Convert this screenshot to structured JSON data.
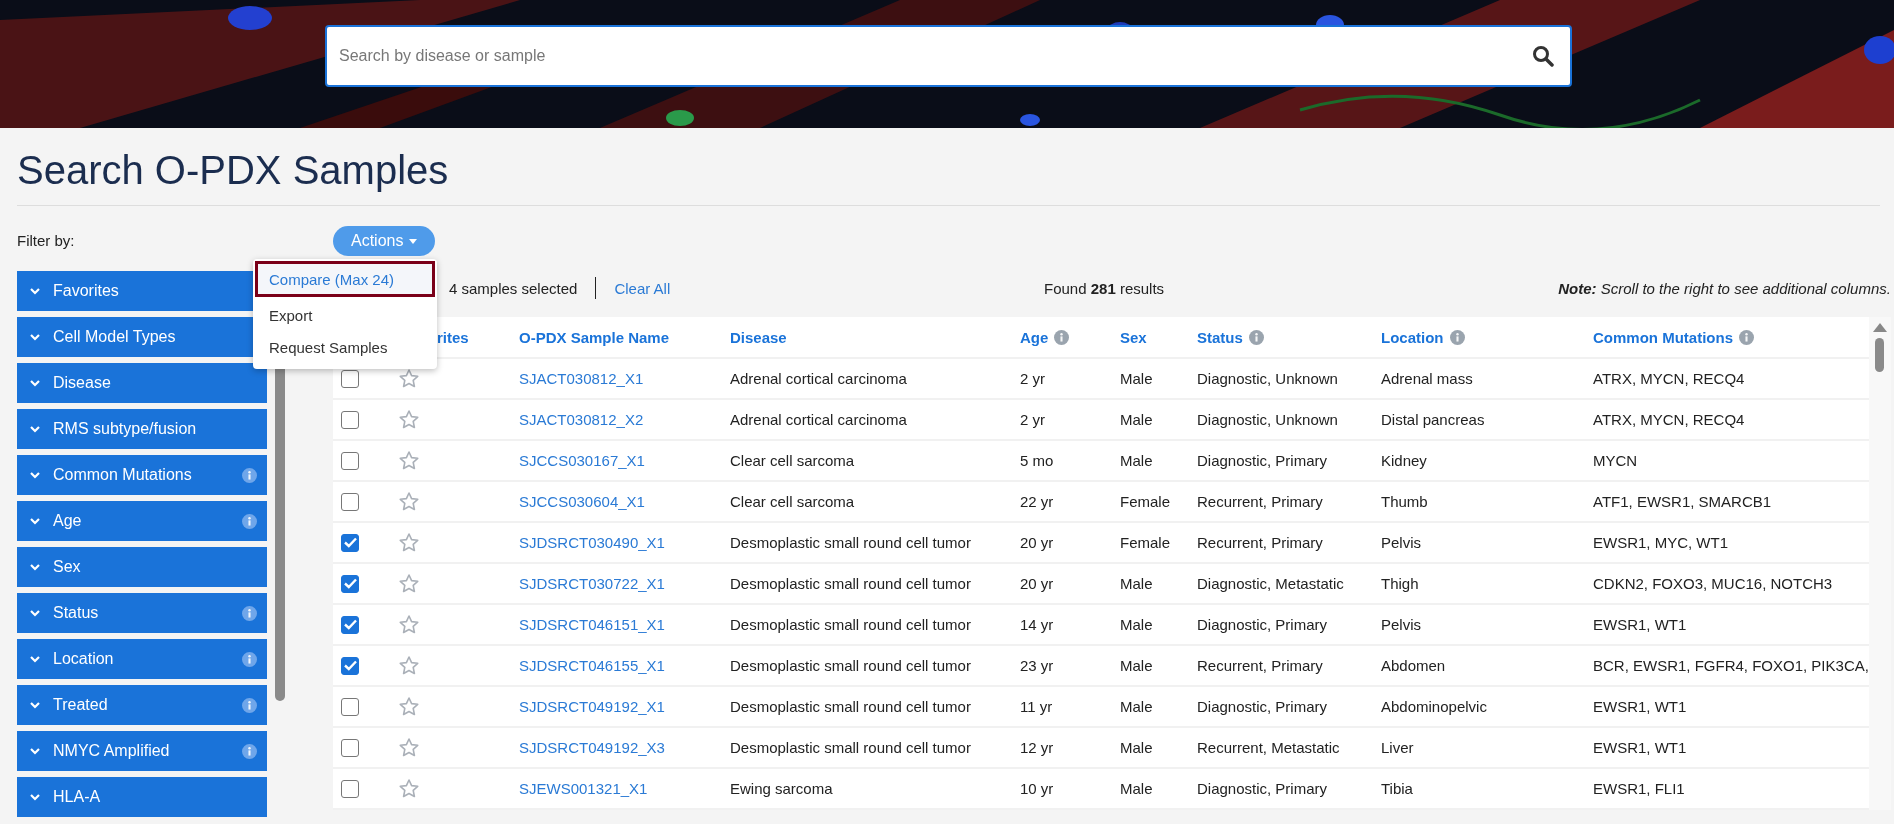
{
  "search": {
    "placeholder": "Search by disease or sample"
  },
  "title": "Search O-PDX Samples",
  "filter_label": "Filter by:",
  "filters": [
    {
      "label": "Favorites",
      "info": false
    },
    {
      "label": "Cell Model Types",
      "info": false
    },
    {
      "label": "Disease",
      "info": false
    },
    {
      "label": "RMS subtype/fusion",
      "info": false
    },
    {
      "label": "Common Mutations",
      "info": true
    },
    {
      "label": "Age",
      "info": true
    },
    {
      "label": "Sex",
      "info": false
    },
    {
      "label": "Status",
      "info": true
    },
    {
      "label": "Location",
      "info": true
    },
    {
      "label": "Treated",
      "info": true
    },
    {
      "label": "NMYC Amplified",
      "info": true
    },
    {
      "label": "HLA-A",
      "info": false
    }
  ],
  "actions": {
    "label": "Actions",
    "menu": [
      {
        "label": "Compare (Max 24)",
        "selected": true
      },
      {
        "label": "Export",
        "selected": false
      },
      {
        "label": "Request Samples",
        "selected": false
      }
    ]
  },
  "selection": {
    "count": "4 samples selected",
    "clear": "Clear All"
  },
  "results": "Found **281** results",
  "note": "**Note:** Scroll to the right to see additional columns.",
  "columns": [
    {
      "label": "rites",
      "info": false
    },
    {
      "label": "O-PDX Sample Name",
      "info": false
    },
    {
      "label": "Disease",
      "info": false
    },
    {
      "label": "Age",
      "info": true
    },
    {
      "label": "Sex",
      "info": false
    },
    {
      "label": "Status",
      "info": true
    },
    {
      "label": "Location",
      "info": true
    },
    {
      "label": "Common Mutations",
      "info": true
    }
  ],
  "rows": [
    {
      "checked": false,
      "favorite": false,
      "cells": [
        "SJACT030812_X1",
        "Adrenal cortical carcinoma",
        "2 yr",
        "Male",
        "Diagnostic, Unknown",
        "Adrenal mass",
        "ATRX, MYCN, RECQ4"
      ]
    },
    {
      "checked": false,
      "favorite": false,
      "cells": [
        "SJACT030812_X2",
        "Adrenal cortical carcinoma",
        "2 yr",
        "Male",
        "Diagnostic, Unknown",
        "Distal pancreas",
        "ATRX, MYCN, RECQ4"
      ]
    },
    {
      "checked": false,
      "favorite": false,
      "cells": [
        "SJCCS030167_X1",
        "Clear cell sarcoma",
        "5 mo",
        "Male",
        "Diagnostic, Primary",
        "Kidney",
        "MYCN"
      ]
    },
    {
      "checked": false,
      "favorite": false,
      "cells": [
        "SJCCS030604_X1",
        "Clear cell sarcoma",
        "22 yr",
        "Female",
        "Recurrent, Primary",
        "Thumb",
        "ATF1, EWSR1, SMARCB1"
      ]
    },
    {
      "checked": true,
      "favorite": false,
      "cells": [
        "SJDSRCT030490_X1",
        "Desmoplastic small round cell tumor",
        "20 yr",
        "Female",
        "Recurrent, Primary",
        "Pelvis",
        "EWSR1, MYC, WT1"
      ]
    },
    {
      "checked": true,
      "favorite": false,
      "cells": [
        "SJDSRCT030722_X1",
        "Desmoplastic small round cell tumor",
        "20 yr",
        "Male",
        "Diagnostic, Metastatic",
        "Thigh",
        "CDKN2, FOXO3, MUC16, NOTCH3"
      ]
    },
    {
      "checked": true,
      "favorite": false,
      "cells": [
        "SJDSRCT046151_X1",
        "Desmoplastic small round cell tumor",
        "14 yr",
        "Male",
        "Diagnostic, Primary",
        "Pelvis",
        "EWSR1, WT1"
      ]
    },
    {
      "checked": true,
      "favorite": false,
      "cells": [
        "SJDSRCT046155_X1",
        "Desmoplastic small round cell tumor",
        "23 yr",
        "Male",
        "Recurrent, Primary",
        "Abdomen",
        "BCR, EWSR1, FGFR4, FOXO1, PIK3CA,"
      ]
    },
    {
      "checked": false,
      "favorite": false,
      "cells": [
        "SJDSRCT049192_X1",
        "Desmoplastic small round cell tumor",
        "11 yr",
        "Male",
        "Diagnostic, Primary",
        "Abdominopelvic",
        "EWSR1, WT1"
      ]
    },
    {
      "checked": false,
      "favorite": false,
      "cells": [
        "SJDSRCT049192_X3",
        "Desmoplastic small round cell tumor",
        "12 yr",
        "Male",
        "Recurrent, Metastatic",
        "Liver",
        "EWSR1, WT1"
      ]
    },
    {
      "checked": false,
      "favorite": false,
      "cells": [
        "SJEWS001321_X1",
        "Ewing sarcoma",
        "10 yr",
        "Male",
        "Diagnostic, Primary",
        "Tibia",
        "EWSR1, FLI1"
      ]
    }
  ]
}
